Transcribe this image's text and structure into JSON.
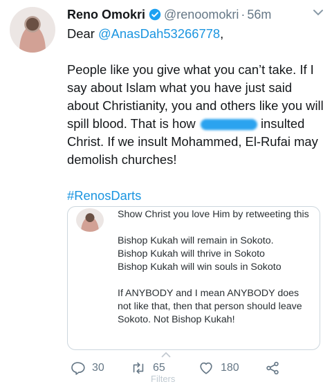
{
  "tweet": {
    "author_name": "Reno Omokri",
    "verified": true,
    "handle": "@renoomokri",
    "separator": "·",
    "time": "56m",
    "salutation": "Dear",
    "mention": "@AnasDah53266778",
    "after_mention": ",",
    "body_before_redaction": "People like you give what you can’t take. If I say about Islam what you have just said about Christianity, you and others like you will spill blood. That is how",
    "body_after_redaction": "insulted Christ. If we insult Mohammed, El-Rufai may demolish churches!",
    "hashtag": "#RenosDarts"
  },
  "quoted_tweet": {
    "line1": "Show Christ you love Him by retweeting this",
    "lines_block1": [
      "Bishop Kukah will remain in Sokoto.",
      "Bishop Kukah will thrive in Sokoto",
      "Bishop Kukah will win souls in Sokoto"
    ],
    "block2": "If ANYBODY and I mean ANYBODY does not like that, then that person should leave Sokoto. Not Bishop Kukah!"
  },
  "actions": {
    "replies": "30",
    "retweets": "65",
    "likes": "180"
  },
  "overlay": {
    "filters_label": "Filters"
  },
  "colors": {
    "link": "#1b95e0",
    "muted": "#657786",
    "border": "#ccd6dd",
    "text": "#14171a"
  },
  "icons": [
    "verified-badge-icon",
    "chevron-down-icon",
    "reply-icon",
    "retweet-icon",
    "like-icon",
    "share-icon",
    "chevron-up-icon"
  ]
}
